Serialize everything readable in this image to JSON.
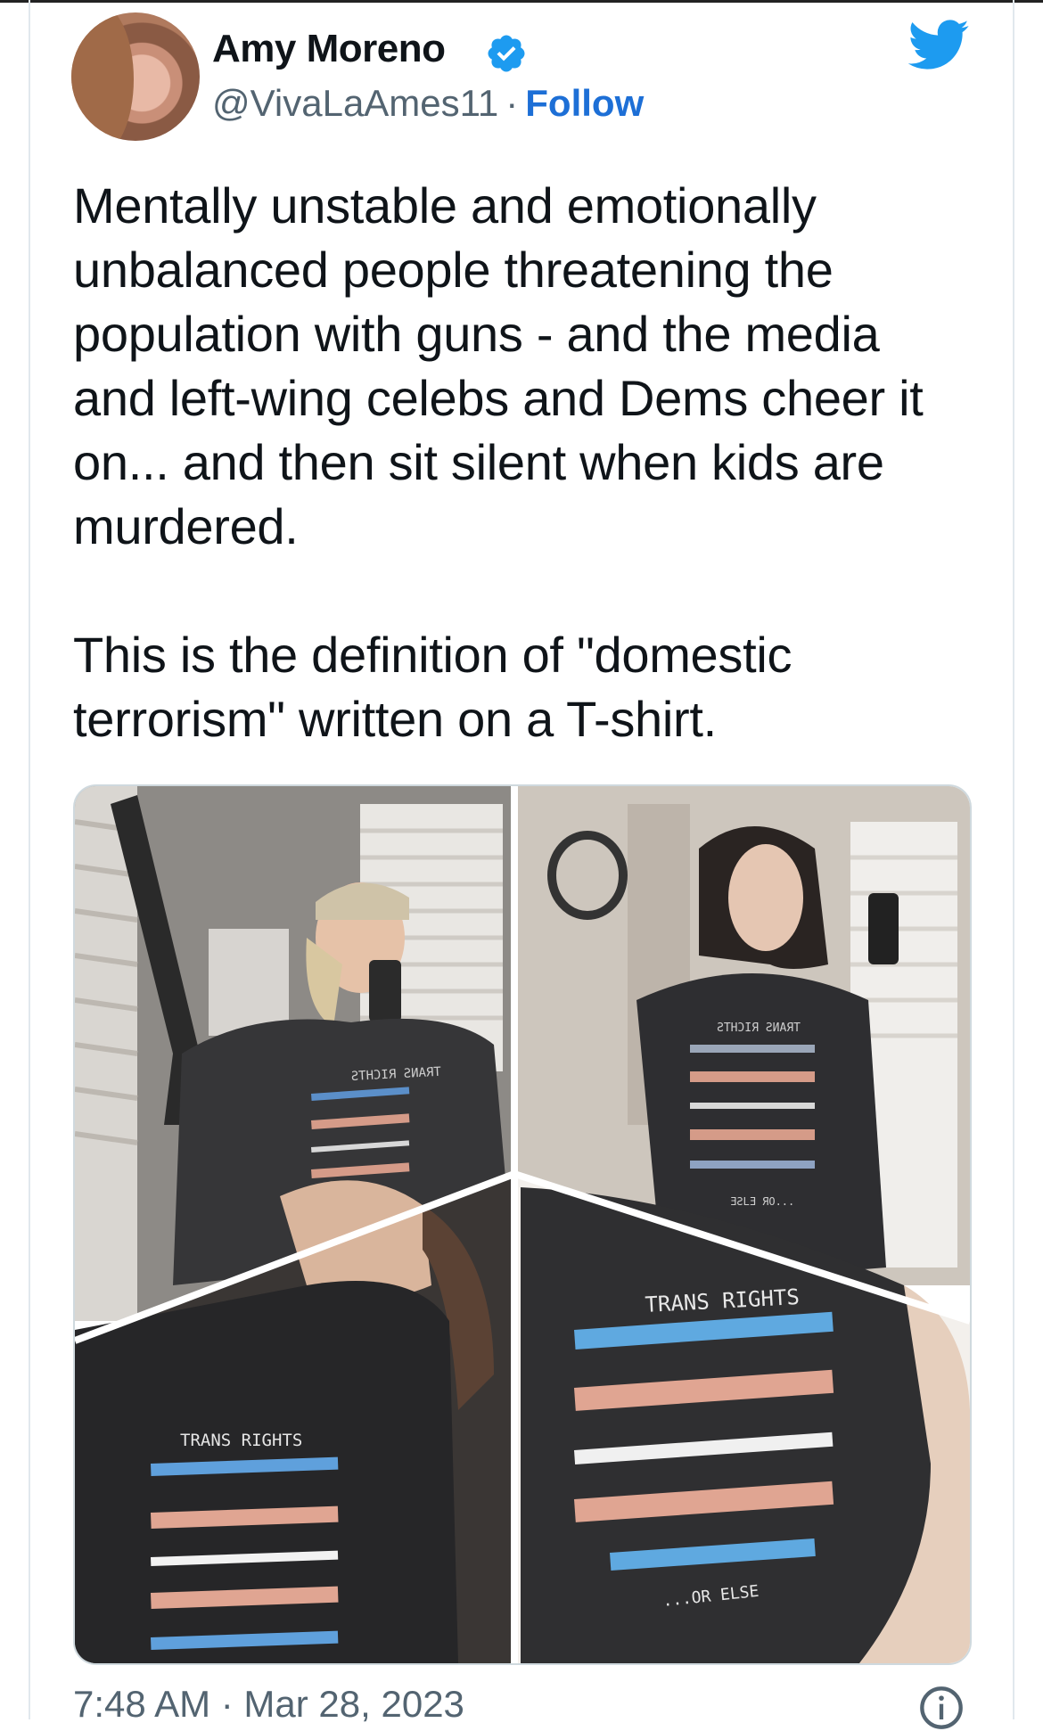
{
  "tweet": {
    "author": {
      "name": "Amy Moreno",
      "handle": "@VivaLaAmes11",
      "separator": "·",
      "follow_label": "Follow",
      "avatar_icon": "avatar-photo",
      "verified_icon": "verified-badge-icon"
    },
    "brand_icon": "twitter-bird-icon",
    "brand_color": "#1d9bf0",
    "text_paragraphs": [
      "Mentally unstable and emotionally unbalanced people threatening the population with guns - and the media and left-wing celebs and Dems cheer it on... and then sit silent when kids are murdered.",
      "This is the definition of \"domestic terrorism\" written on a T-shirt."
    ],
    "media": {
      "shirt_text_top_left": "ƧTHƆIЯ ƧИAЯT",
      "shirt_text_top_right": "ƧTHƆIЯ ƧИAЯT",
      "shirt_text_top_right_bottom": "ƎƧLƎ ЯO...",
      "shirt_text_bottom_left": "TRANS RIGHTS",
      "shirt_text_bottom_right": "TRANS RIGHTS",
      "shirt_text_bottom_right_bottom": "...OR ELSE"
    },
    "timestamp": "7:48 AM · Mar 28, 2023",
    "info_icon": "info-icon"
  }
}
